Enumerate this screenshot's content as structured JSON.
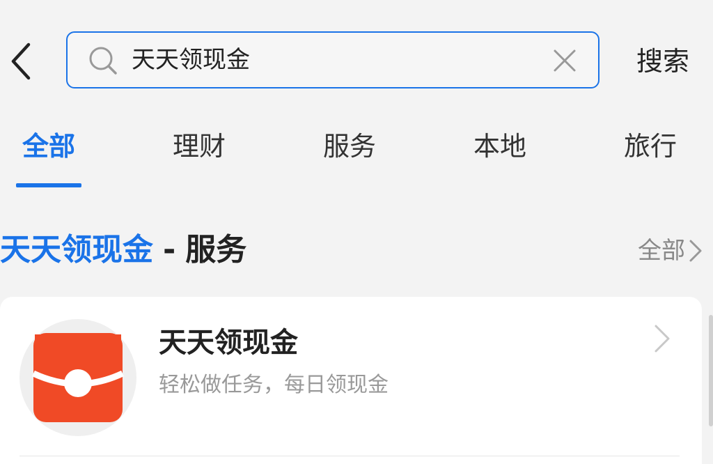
{
  "search": {
    "query": "天天领现金",
    "submit_label": "搜索"
  },
  "tabs": [
    {
      "label": "全部",
      "active": true
    },
    {
      "label": "理财",
      "active": false
    },
    {
      "label": "服务",
      "active": false
    },
    {
      "label": "本地",
      "active": false
    },
    {
      "label": "旅行",
      "active": false
    }
  ],
  "section": {
    "title_highlight": "天天领现金",
    "title_separator": "-",
    "title_category": "服务",
    "more_label": "全部"
  },
  "result": {
    "name": "天天领现金",
    "description": "轻松做任务，每日领现金",
    "logo_icon": "red-envelope-icon"
  },
  "colors": {
    "accent": "#1a73e8",
    "logo_red": "#f04a26",
    "background": "#f3f3f3"
  }
}
